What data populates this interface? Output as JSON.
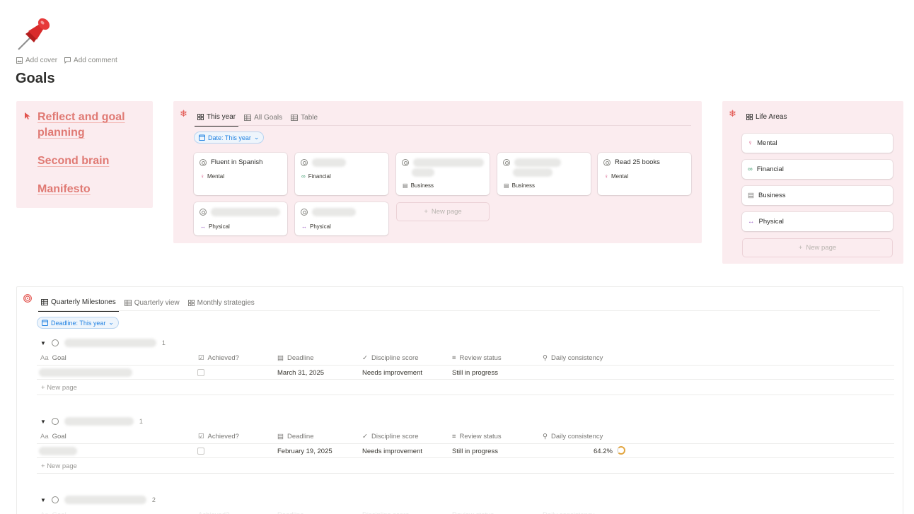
{
  "page": {
    "title": "Goals",
    "actions": {
      "add_cover": "Add cover",
      "add_comment": "Add comment"
    }
  },
  "links": [
    {
      "label": "Reflect and goal planning"
    },
    {
      "label": "Second brain"
    },
    {
      "label": "Manifesto"
    }
  ],
  "goals_board": {
    "tabs": [
      "This year",
      "All Goals",
      "Table"
    ],
    "filter": "Date: This year",
    "cards": [
      {
        "title": "Fluent in Spanish",
        "tag": "Mental"
      },
      {
        "title": "",
        "tag": "Financial"
      },
      {
        "title": "",
        "tag": "Business"
      },
      {
        "title": "",
        "tag": "Business"
      },
      {
        "title": "Read 25 books",
        "tag": "Mental"
      },
      {
        "title": "",
        "tag": "Physical"
      },
      {
        "title": "",
        "tag": "Physical"
      }
    ],
    "new_page": "New page"
  },
  "life_areas": {
    "tab": "Life Areas",
    "items": [
      "Mental",
      "Financial",
      "Business",
      "Physical"
    ],
    "new_page": "New page"
  },
  "milestones": {
    "tabs": [
      "Quarterly Milestones",
      "Quarterly view",
      "Monthly strategies"
    ],
    "filter": "Deadline: This year",
    "columns": {
      "goal": "Goal",
      "goal_prefix": "Aa",
      "achieved": "Achieved?",
      "deadline": "Deadline",
      "discipline": "Discipline score",
      "review": "Review status",
      "consistency": "Daily consistency"
    },
    "groups": [
      {
        "count": "1",
        "rows": [
          {
            "deadline": "March 31, 2025",
            "discipline": "Needs improvement",
            "review": "Still in progress",
            "consistency": ""
          }
        ]
      },
      {
        "count": "1",
        "rows": [
          {
            "deadline": "February 19, 2025",
            "discipline": "Needs improvement",
            "review": "Still in progress",
            "consistency": "64.2%"
          }
        ]
      },
      {
        "count": "2",
        "rows": []
      }
    ],
    "new_page": "New page"
  },
  "colors": {
    "accent_red": "#e2534d",
    "link_pink": "#e07a74",
    "panel_pink": "#fbecef",
    "blue": "#2383e2"
  }
}
